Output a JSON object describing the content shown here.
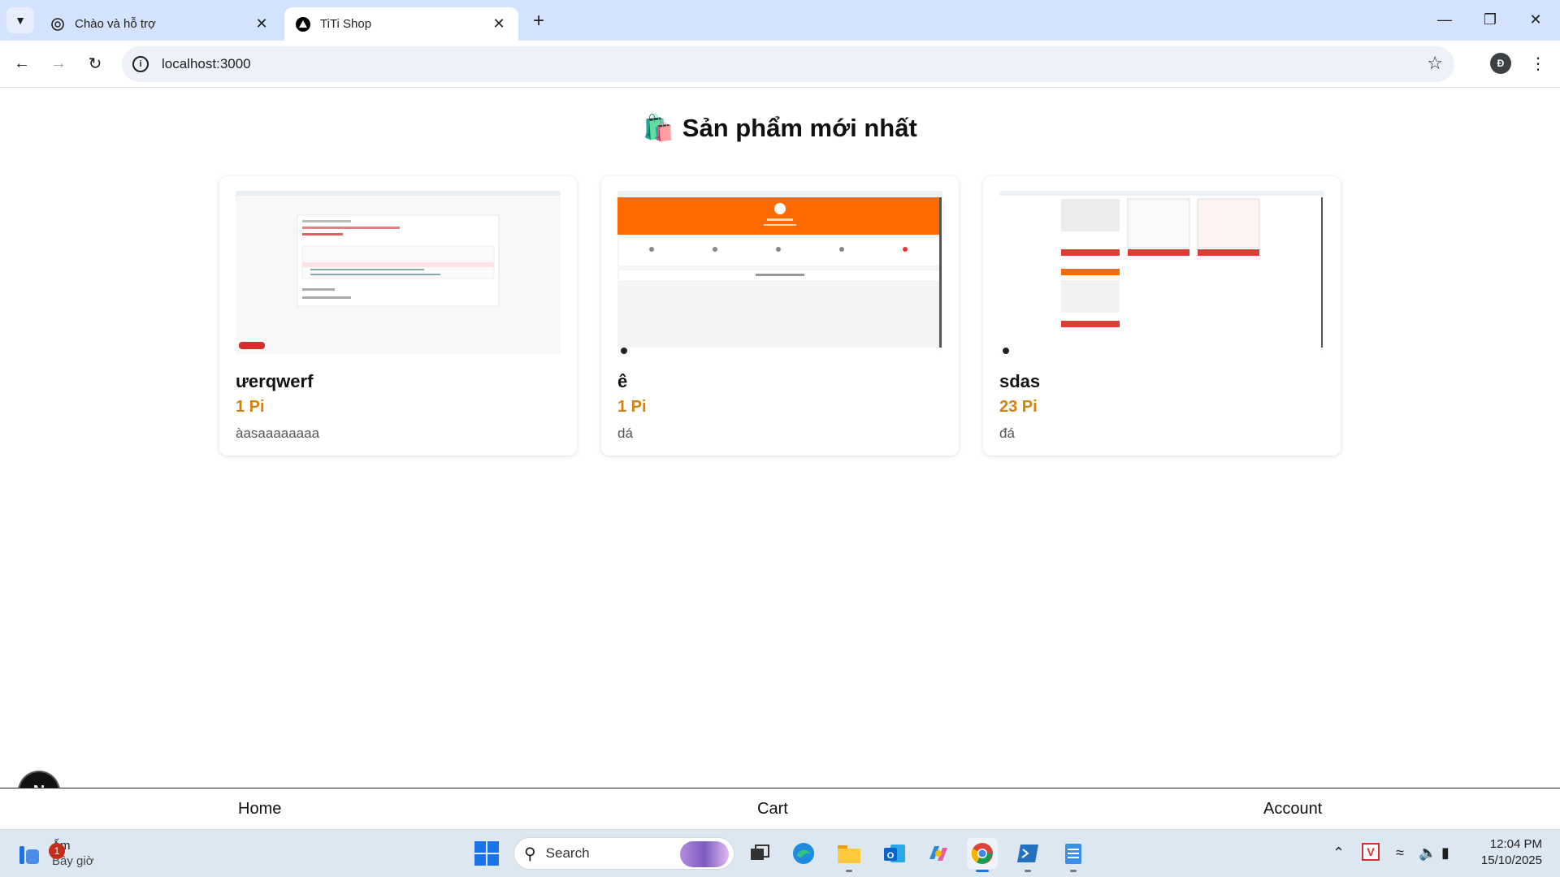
{
  "browser": {
    "tabs": [
      {
        "title": "Chào và hỗ trợ",
        "active": false
      },
      {
        "title": "TiTi Shop",
        "active": true
      }
    ],
    "url": "localhost:3000",
    "profile_initial": "Đ"
  },
  "page": {
    "heading_emoji": "🛍️",
    "heading": "Sản phẩm mới nhất",
    "products": [
      {
        "name": "ưerqwerf",
        "price": "1 Pi",
        "description": "àasaaaaaaaa"
      },
      {
        "name": "ê",
        "price": "1 Pi",
        "description": "dá"
      },
      {
        "name": "sdas",
        "price": "23 Pi",
        "description": "đá"
      }
    ],
    "next_badge": "N",
    "bottom_nav": {
      "home": "Home",
      "cart": "Cart",
      "account": "Account"
    }
  },
  "taskbar": {
    "weather_badge": "1",
    "weather_title": "Ấm",
    "weather_sub": "Bây giờ",
    "search_placeholder": "Search",
    "time": "12:04 PM",
    "date": "15/10/2025"
  },
  "colors": {
    "price": "#d4820a",
    "tabbar": "#d3e3fd",
    "orange_banner": "#ff6a00"
  }
}
